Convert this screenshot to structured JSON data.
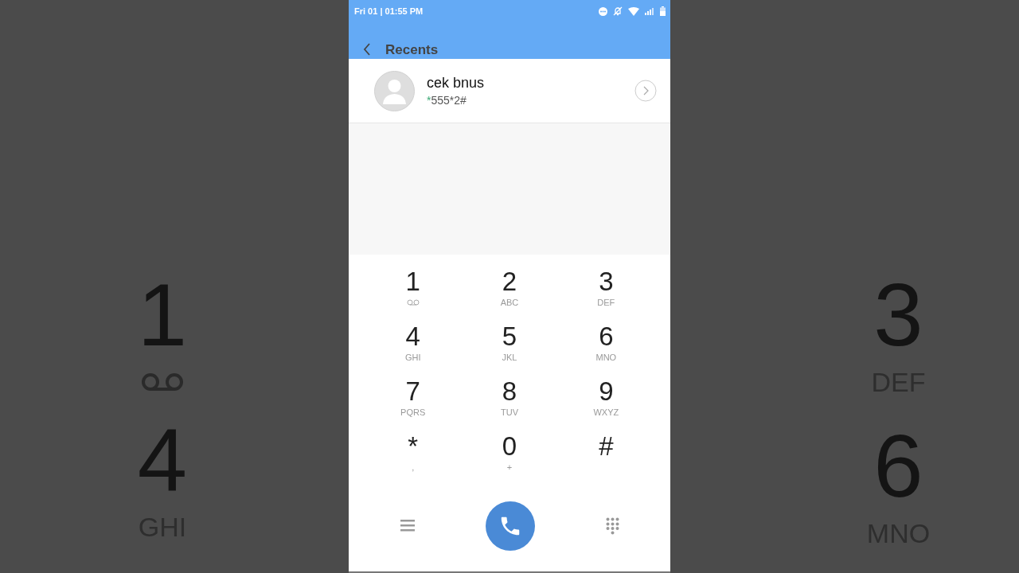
{
  "backdrop": {
    "left": [
      {
        "digit": "1",
        "kind": "voicemail"
      },
      {
        "digit": "4",
        "letters": "GHI",
        "kind": "letters"
      }
    ],
    "right": [
      {
        "digit": "3",
        "letters": "DEF",
        "kind": "letters"
      },
      {
        "digit": "6",
        "letters": "MNO",
        "kind": "letters"
      }
    ]
  },
  "status_bar": {
    "time": "Fri 01 | 01:55 PM"
  },
  "header": {
    "title": "Recents"
  },
  "contact": {
    "name": "cek bnus",
    "number": "*555*2#"
  },
  "keys": [
    {
      "digit": "1",
      "kind": "voicemail"
    },
    {
      "digit": "2",
      "letters": "ABC",
      "kind": "letters"
    },
    {
      "digit": "3",
      "letters": "DEF",
      "kind": "letters"
    },
    {
      "digit": "4",
      "letters": "GHI",
      "kind": "letters"
    },
    {
      "digit": "5",
      "letters": "JKL",
      "kind": "letters"
    },
    {
      "digit": "6",
      "letters": "MNO",
      "kind": "letters"
    },
    {
      "digit": "7",
      "letters": "PQRS",
      "kind": "letters"
    },
    {
      "digit": "8",
      "letters": "TUV",
      "kind": "letters"
    },
    {
      "digit": "9",
      "letters": "WXYZ",
      "kind": "letters"
    },
    {
      "digit": "*",
      "letters": ",",
      "kind": "letters"
    },
    {
      "digit": "0",
      "letters": "+",
      "kind": "letters"
    },
    {
      "digit": "#",
      "kind": "none"
    }
  ]
}
